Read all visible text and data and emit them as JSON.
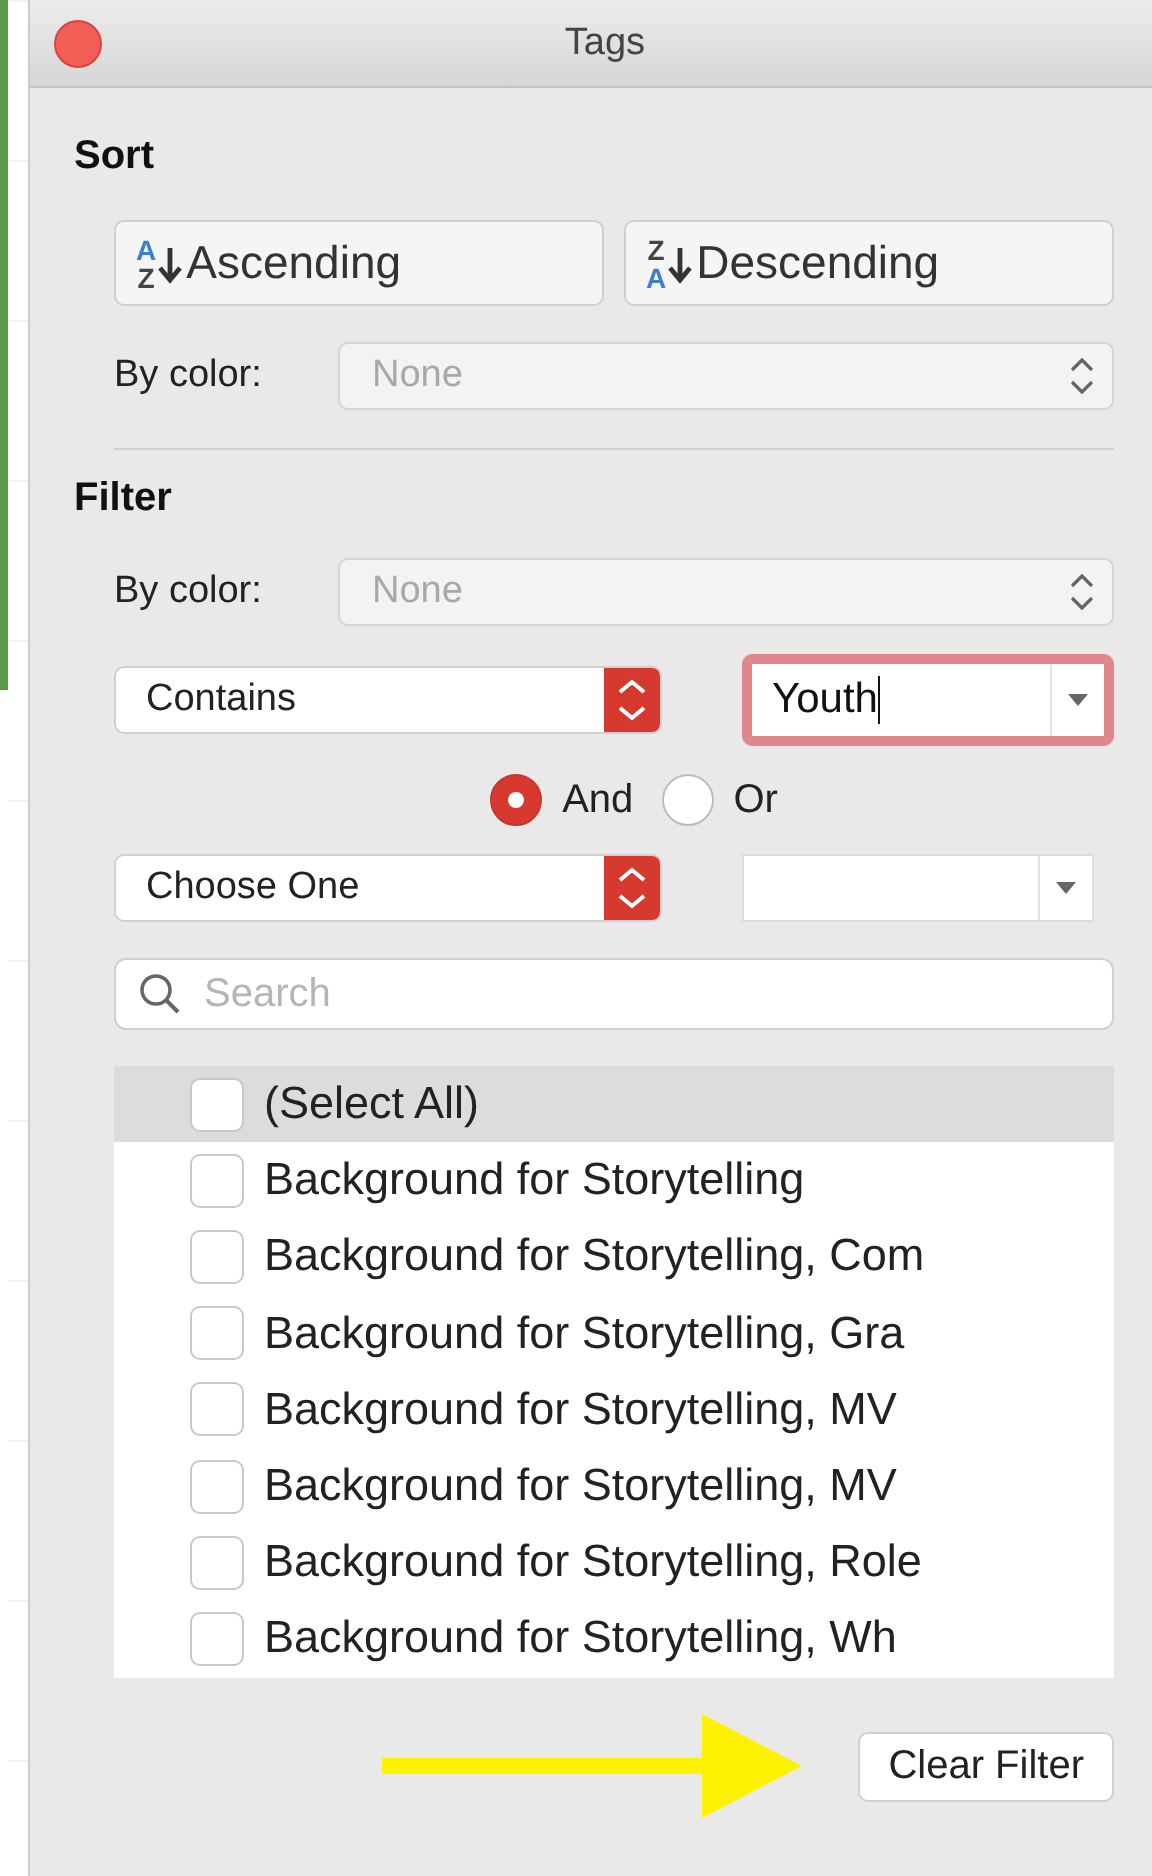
{
  "window": {
    "title": "Tags"
  },
  "sort": {
    "heading": "Sort",
    "buttons": [
      {
        "label": "Ascending",
        "icon_letters": [
          "A",
          "Z"
        ]
      },
      {
        "label": "Descending",
        "icon_letters": [
          "Z",
          "A"
        ]
      }
    ],
    "by_color": {
      "label": "By color:",
      "value": "None",
      "disabled": true
    }
  },
  "filter": {
    "heading": "Filter",
    "by_color": {
      "label": "By color:",
      "value": "None",
      "disabled": true
    },
    "condition_1": {
      "operator": "Contains",
      "value": "Youth",
      "focused": true
    },
    "logic": [
      {
        "label": "And",
        "selected": true
      },
      {
        "label": "Or",
        "selected": false
      }
    ],
    "condition_2": {
      "operator": "Choose One",
      "focused": false
    },
    "search": {
      "placeholder": "Search"
    },
    "items": [
      {
        "label": "(Select All)",
        "checked": false,
        "selected": true
      },
      {
        "label": "Background for Storytelling",
        "checked": false,
        "selected": false
      },
      {
        "label": "Background for Storytelling, Com",
        "checked": false,
        "selected": false
      },
      {
        "label": "Background for Storytelling, Gra",
        "checked": false,
        "selected": false
      },
      {
        "label": "Background for Storytelling, MV",
        "checked": false,
        "selected": false
      },
      {
        "label": "Background for Storytelling, MV",
        "checked": false,
        "selected": false
      },
      {
        "label": "Background for Storytelling, Role",
        "checked": false,
        "selected": false
      },
      {
        "label": "Background for Storytelling, Wh",
        "checked": false,
        "selected": false
      }
    ],
    "clear_button": "Clear Filter"
  }
}
